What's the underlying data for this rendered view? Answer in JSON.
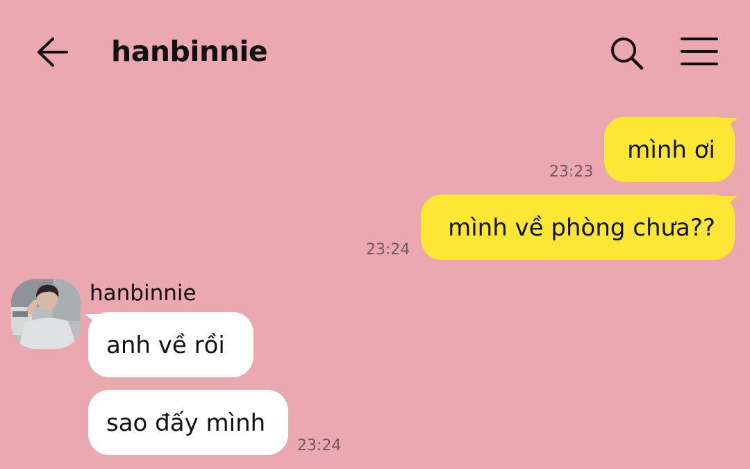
{
  "header": {
    "title": "hanbinnie",
    "back_icon": "arrow-left-icon",
    "search_icon": "search-icon",
    "menu_icon": "hamburger-menu-icon"
  },
  "colors": {
    "background": "#eca8b1",
    "my_bubble": "#fde733",
    "their_bubble": "#ffffff",
    "timestamp": "#6e5a5e"
  },
  "messages": [
    {
      "from": "me",
      "text": "mình ơi",
      "time": "23:23"
    },
    {
      "from": "me",
      "text": "mình về phòng chưa??",
      "time": "23:24"
    },
    {
      "from": "hanbinnie",
      "sender_name": "hanbinnie",
      "text": "anh về rồi",
      "time": ""
    },
    {
      "from": "hanbinnie",
      "text": "sao đấy mình",
      "time": "23:24"
    }
  ]
}
